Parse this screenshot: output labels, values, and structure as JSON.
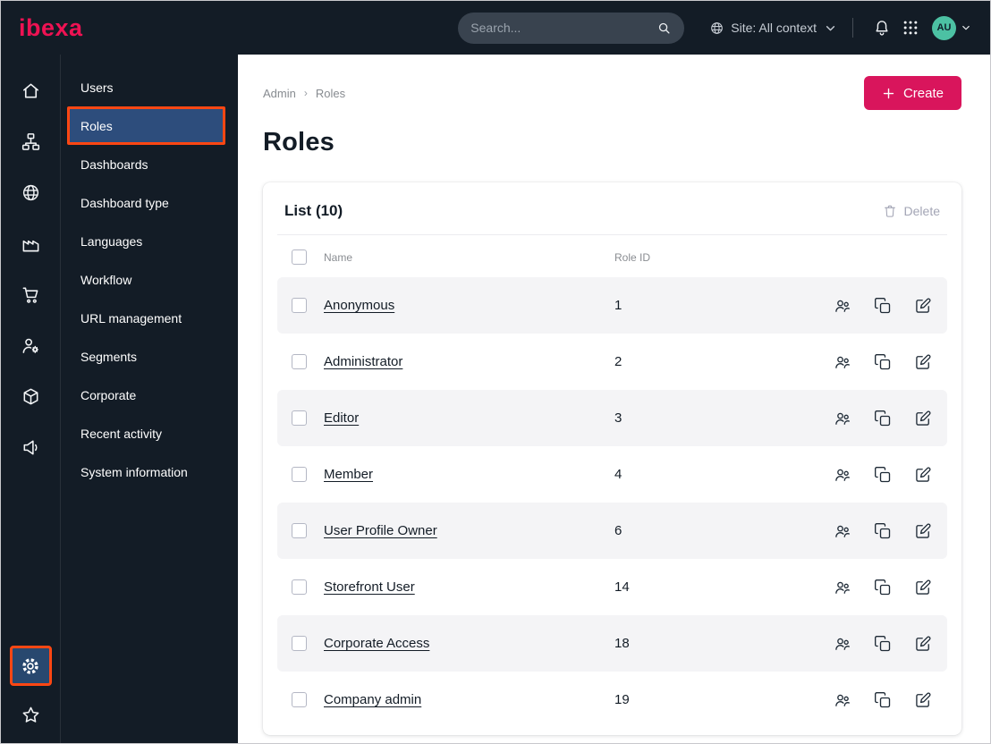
{
  "topbar": {
    "logo": "ibexa",
    "search_placeholder": "Search...",
    "site_context": "Site: All context",
    "avatar": "AU"
  },
  "icon_rail": {
    "items": [
      "home",
      "sitemap",
      "globe",
      "factory",
      "cart",
      "user-settings",
      "package",
      "megaphone"
    ],
    "bottom_items": [
      "settings-gear",
      "star"
    ]
  },
  "sidebar": {
    "items": [
      {
        "label": "Users",
        "selected": false
      },
      {
        "label": "Roles",
        "selected": true
      },
      {
        "label": "Dashboards",
        "selected": false
      },
      {
        "label": "Dashboard type",
        "selected": false
      },
      {
        "label": "Languages",
        "selected": false
      },
      {
        "label": "Workflow",
        "selected": false
      },
      {
        "label": "URL management",
        "selected": false
      },
      {
        "label": "Segments",
        "selected": false
      },
      {
        "label": "Corporate",
        "selected": false
      },
      {
        "label": "Recent activity",
        "selected": false
      },
      {
        "label": "System information",
        "selected": false
      }
    ]
  },
  "main": {
    "breadcrumb": [
      "Admin",
      "Roles"
    ],
    "breadcrumb_separator": "›",
    "create_label": "Create",
    "title": "Roles",
    "list": {
      "title": "List (10)",
      "delete_label": "Delete",
      "columns": [
        "Name",
        "Role ID"
      ],
      "row_actions": [
        "assign-users",
        "copy",
        "edit"
      ],
      "rows": [
        {
          "name": "Anonymous",
          "role_id": "1"
        },
        {
          "name": "Administrator",
          "role_id": "2"
        },
        {
          "name": "Editor",
          "role_id": "3"
        },
        {
          "name": "Member",
          "role_id": "4"
        },
        {
          "name": "User Profile Owner",
          "role_id": "6"
        },
        {
          "name": "Storefront User",
          "role_id": "14"
        },
        {
          "name": "Corporate Access",
          "role_id": "18"
        },
        {
          "name": "Company admin",
          "role_id": "19"
        }
      ]
    }
  },
  "colors": {
    "dark_navy": "#131c26",
    "accent_red": "#d9155c",
    "logo_red": "#ee1253",
    "highlight_orange": "#ff4713",
    "selected_blue": "#2d4d7c",
    "avatar_teal": "#4cc1a3",
    "row_stripe": "#f4f4f6"
  }
}
